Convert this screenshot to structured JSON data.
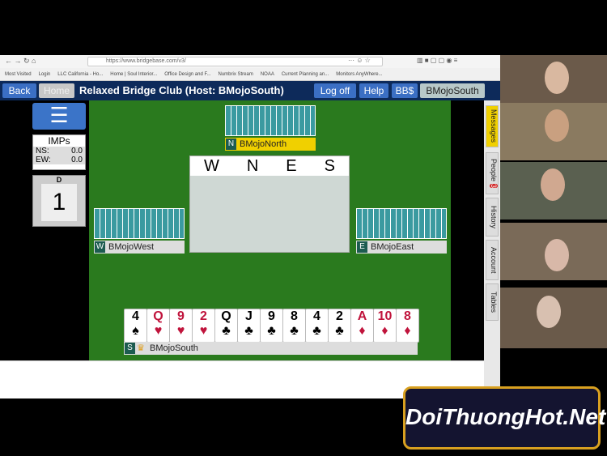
{
  "browser": {
    "url": "https://www.bridgebase.com/v3/",
    "bookmarks": [
      "Most Visited",
      "Login",
      "LLC California - Ho...",
      "Home | Soul Interior...",
      "Office Design and F...",
      "Numbrix Stream",
      "NOAA",
      "Current Planning an...",
      "Monitors AnyWhere..."
    ]
  },
  "header": {
    "back": "Back",
    "home": "Home",
    "title": "Relaxed Bridge Club (Host: BMojoSouth)",
    "logoff": "Log off",
    "help": "Help",
    "bbs": "BB$",
    "user": "BMojoSouth"
  },
  "score": {
    "type": "IMPs",
    "ns_label": "NS:",
    "ns": "0.0",
    "ew_label": "EW:",
    "ew": "0.0"
  },
  "board": {
    "dealer": "D",
    "number": "1"
  },
  "bidding": {
    "cols": [
      "W",
      "N",
      "E",
      "S"
    ]
  },
  "players": {
    "north": {
      "seat": "N",
      "name": "BMojoNorth"
    },
    "west": {
      "seat": "W",
      "name": "BMojoWest"
    },
    "east": {
      "seat": "E",
      "name": "BMojoEast"
    },
    "south": {
      "seat": "S",
      "name": "BMojoSouth"
    }
  },
  "hand": [
    {
      "r": "4",
      "s": "♠",
      "c": "blk"
    },
    {
      "r": "Q",
      "s": "♥",
      "c": "red"
    },
    {
      "r": "9",
      "s": "♥",
      "c": "red"
    },
    {
      "r": "2",
      "s": "♥",
      "c": "red"
    },
    {
      "r": "Q",
      "s": "♣",
      "c": "blk"
    },
    {
      "r": "J",
      "s": "♣",
      "c": "blk"
    },
    {
      "r": "9",
      "s": "♣",
      "c": "blk"
    },
    {
      "r": "8",
      "s": "♣",
      "c": "blk"
    },
    {
      "r": "4",
      "s": "♣",
      "c": "blk"
    },
    {
      "r": "2",
      "s": "♣",
      "c": "blk"
    },
    {
      "r": "A",
      "s": "♦",
      "c": "red"
    },
    {
      "r": "10",
      "s": "♦",
      "c": "red"
    },
    {
      "r": "8",
      "s": "♦",
      "c": "red"
    }
  ],
  "sidetabs": {
    "messages": "Messages",
    "people": "People",
    "people_count": "3",
    "history": "History",
    "account": "Account",
    "tables": "Tables"
  },
  "watermark": "DoiThuongHot.Net"
}
